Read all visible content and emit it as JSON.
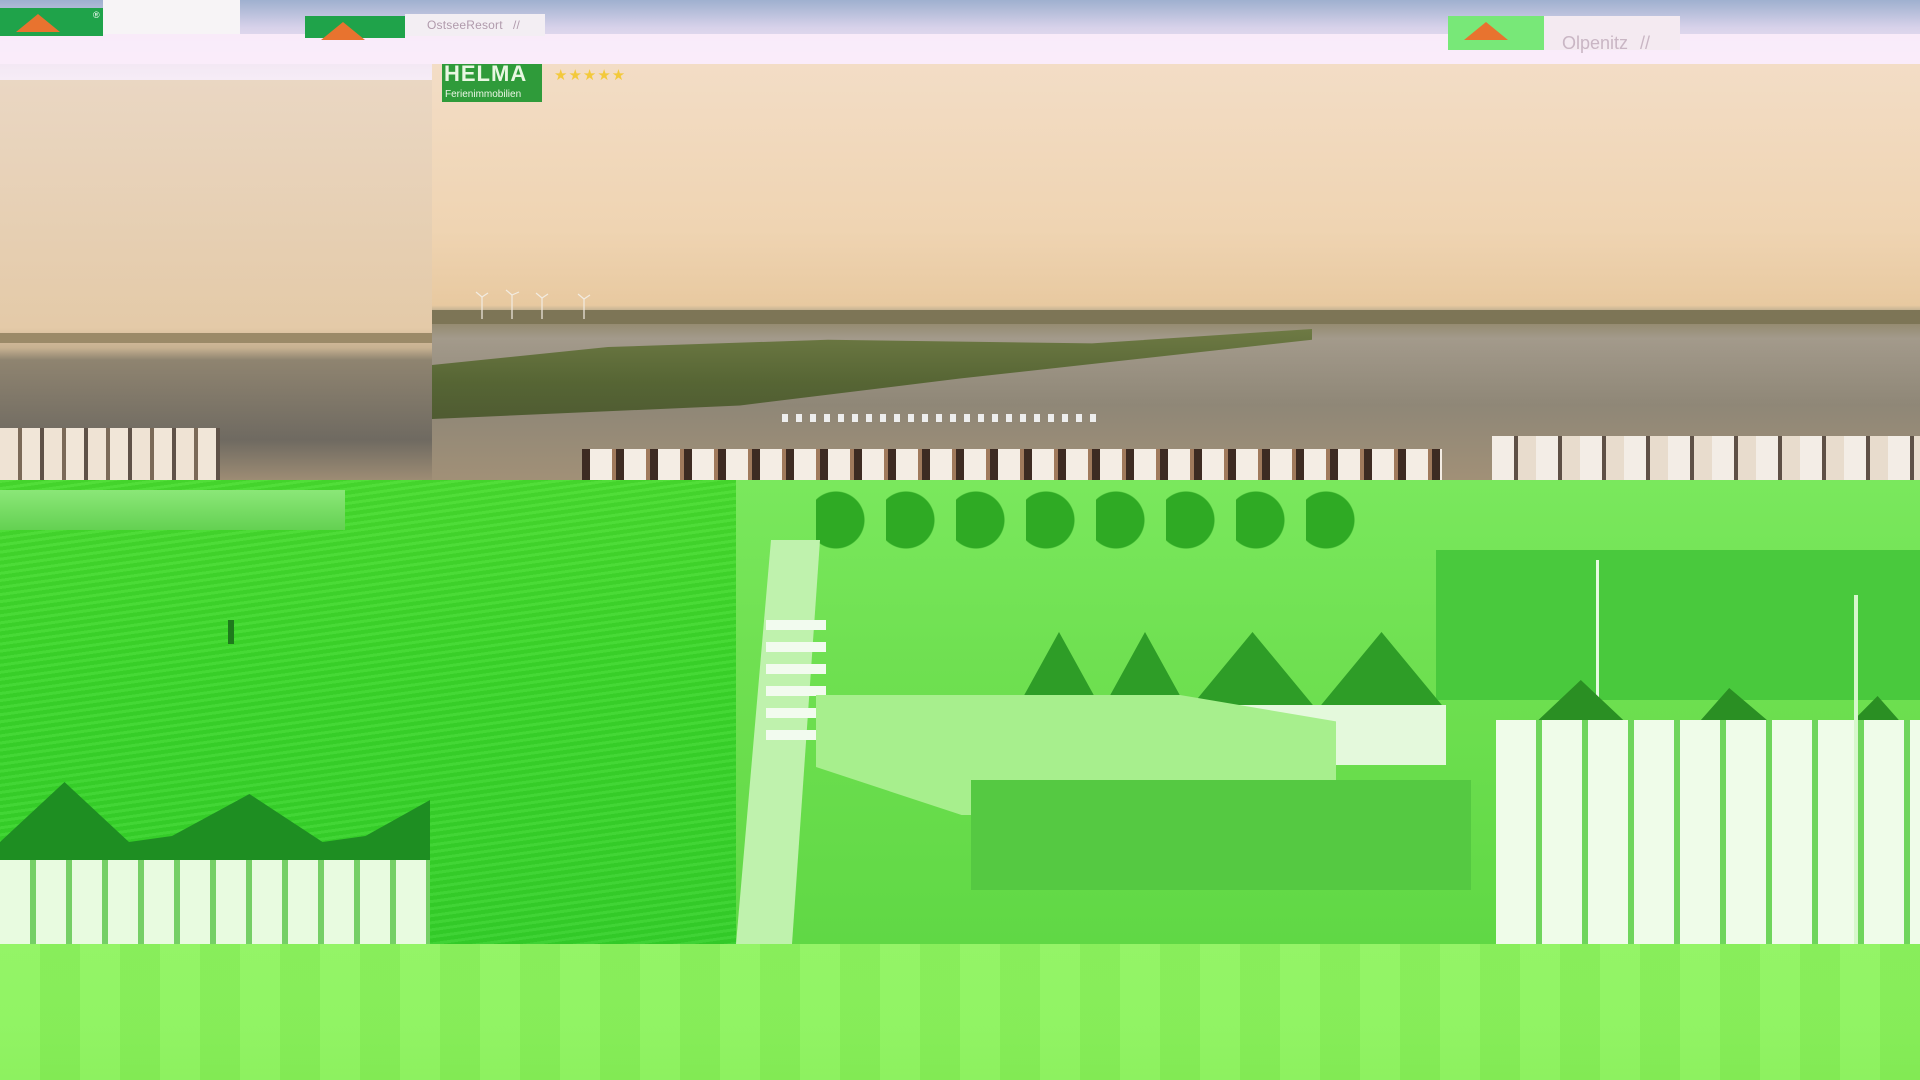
{
  "header": {
    "resort_label": "OstseeResort",
    "location_label": "Olpenitz",
    "slash": "//",
    "registered_mark": "®"
  },
  "overlay": {
    "brand_name": "HELMA",
    "brand_subtitle": "Ferienimmobilien",
    "rating": "★★★★★"
  },
  "colors": {
    "brand_green": "#2f9b3a",
    "roof_orange": "#e8732f",
    "tint_green": "#3bd72a",
    "sky": "#efd4b2"
  }
}
